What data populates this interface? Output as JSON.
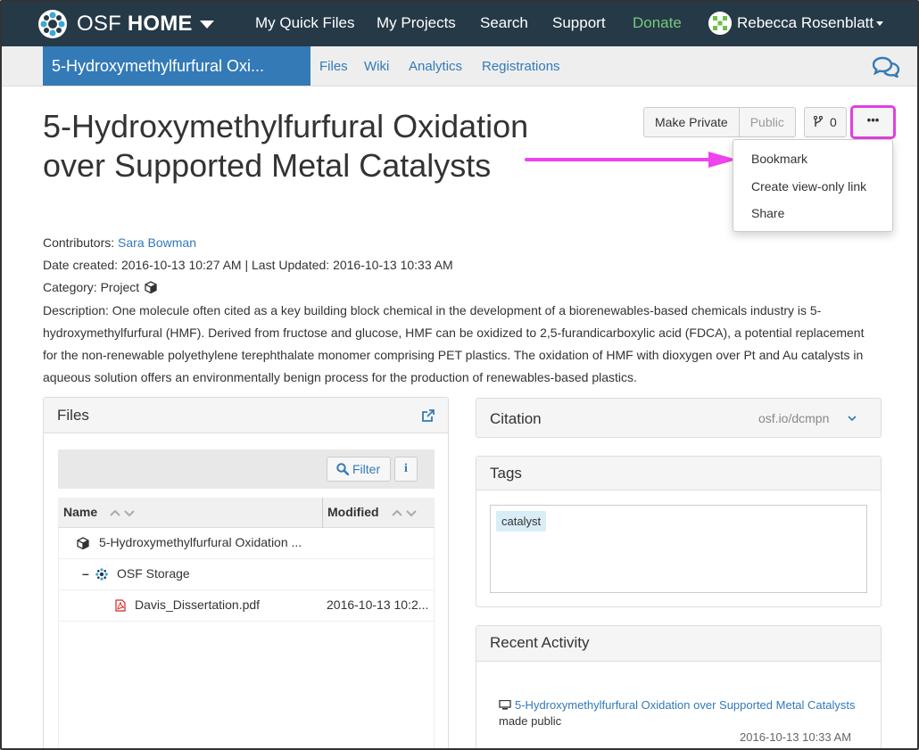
{
  "navbar": {
    "brand_light": "OSF",
    "brand_bold": "HOME",
    "links": [
      "My Quick Files",
      "My Projects",
      "Search",
      "Support"
    ],
    "donate": "Donate",
    "user_name": "Rebecca Rosenblatt"
  },
  "subnav": {
    "project_tab": "5-Hydroxymethylfurfural Oxi...",
    "links": [
      "Files",
      "Wiki",
      "Analytics",
      "Registrations"
    ]
  },
  "project": {
    "title": "5-Hydroxymethylfurfural Oxidation over Supported Metal Catalysts",
    "contributors_label": "Contributors:",
    "contributor": "Sara Bowman",
    "dates": "Date created: 2016-10-13 10:27 AM | Last Updated: 2016-10-13 10:33 AM",
    "category": "Category: Project",
    "description": "Description: One molecule often cited as a key building block chemical in the development of a biorenewables-based chemicals industry is 5-hydroxymethylfurfural (HMF). Derived from fructose and glucose, HMF can be oxidized to 2,5-furandicarboxylic acid (FDCA), a potential replacement for the non-renewable polyethylene terephthalate monomer comprising PET plastics. The oxidation of HMF with dioxygen over Pt and Au catalysts in aqueous solution offers an environmentally benign process for the production of renewables-based plastics."
  },
  "actions": {
    "make_private": "Make Private",
    "public": "Public",
    "fork_count": "0",
    "more": "•••",
    "dropdown": [
      "Bookmark",
      "Create view-only link",
      "Share"
    ]
  },
  "files": {
    "title": "Files",
    "filter": "Filter",
    "info": "i",
    "col_name": "Name",
    "col_modified": "Modified",
    "rows": [
      {
        "name": "5-Hydroxymethylfurfural Oxidation ...",
        "modified": ""
      },
      {
        "name": "OSF Storage",
        "modified": ""
      },
      {
        "name": "Davis_Dissertation.pdf",
        "modified": "2016-10-13 10:2..."
      }
    ]
  },
  "citation": {
    "title": "Citation",
    "link": "osf.io/dcmpn"
  },
  "tags": {
    "title": "Tags",
    "items": [
      "catalyst"
    ]
  },
  "activity": {
    "title": "Recent Activity",
    "link_text": "5-Hydroxymethylfurfural Oxidation over Supported Metal Catalysts",
    "suffix": " made public",
    "time": "2016-10-13 10:33 AM"
  },
  "colors": {
    "navbar": "#263947",
    "primary": "#337ab7",
    "donate": "#77c97d",
    "highlight": "#e040e0"
  }
}
